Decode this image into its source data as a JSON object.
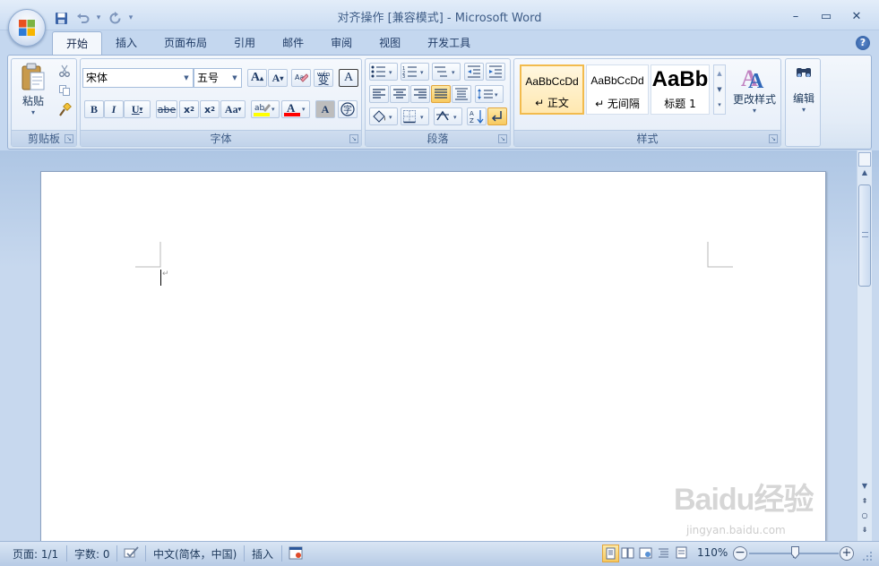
{
  "window": {
    "title": "对齐操作 [兼容模式] - Microsoft Word"
  },
  "qat": {
    "save": "save-icon",
    "undo": "undo-icon",
    "redo": "redo-icon",
    "customize": "▾"
  },
  "window_controls": {
    "minimize": "–",
    "maximize": "▭",
    "close": "✕"
  },
  "tabs": [
    "开始",
    "插入",
    "页面布局",
    "引用",
    "邮件",
    "审阅",
    "视图",
    "开发工具"
  ],
  "active_tab": "开始",
  "ribbon": {
    "clipboard": {
      "label": "剪贴板",
      "paste": "粘贴"
    },
    "font": {
      "label": "字体",
      "font_name": "宋体",
      "font_size": "五号",
      "phonetic": "wén",
      "phonetic_char": "变"
    },
    "paragraph": {
      "label": "段落"
    },
    "styles": {
      "label": "样式",
      "items": [
        {
          "preview": "AaBbCcDd",
          "name": "↵ 正文"
        },
        {
          "preview": "AaBbCcDd",
          "name": "↵ 无间隔"
        },
        {
          "preview": "AaBb",
          "name": "标题 1"
        }
      ],
      "change_styles": "更改样式"
    },
    "editing": {
      "label": "编辑"
    }
  },
  "status": {
    "page": "页面: 1/1",
    "words": "字数: 0",
    "language": "中文(简体，中国)",
    "mode": "插入",
    "zoom": "110%",
    "zoom_level": 1.1
  },
  "watermark": {
    "brand": "Baidu经验",
    "url": "jingyan.baidu.com"
  },
  "colors": {
    "accent": "#2b579a",
    "highlight": "#ffff00",
    "font_color": "#ff0000",
    "selected_style": "#f2bb4d"
  }
}
